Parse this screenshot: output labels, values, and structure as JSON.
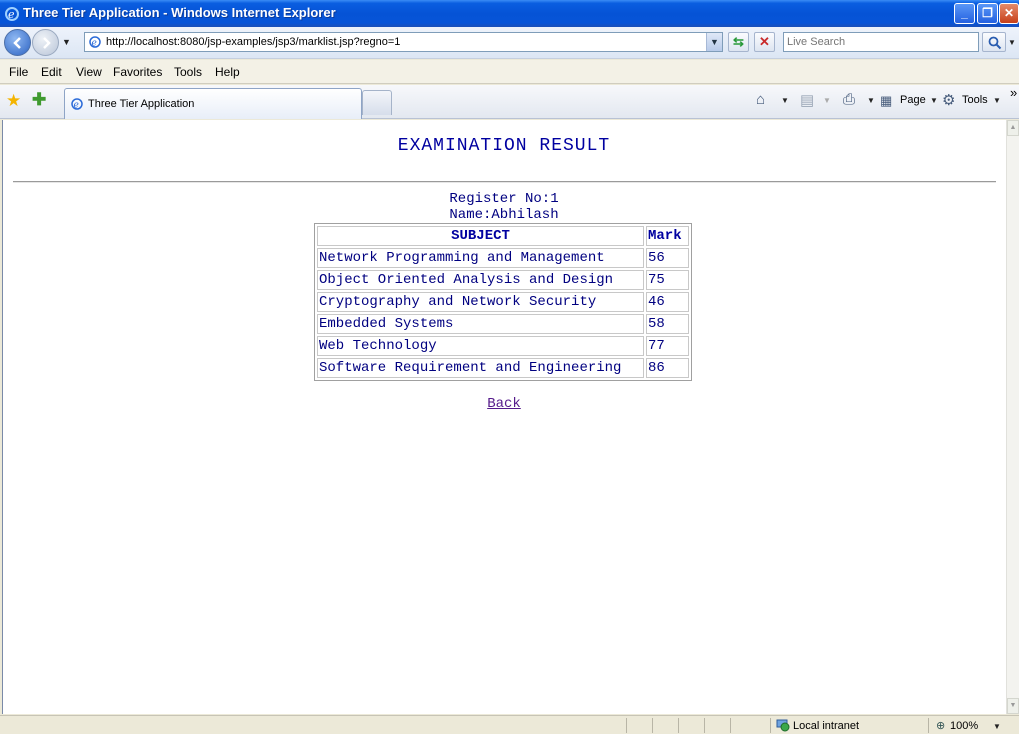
{
  "window": {
    "title": "Three Tier Application - Windows Internet Explorer"
  },
  "address_bar": {
    "url": "http://localhost:8080/jsp-examples/jsp3/marklist.jsp?regno=1"
  },
  "search": {
    "placeholder": "Live Search"
  },
  "menu": [
    "File",
    "Edit",
    "View",
    "Favorites",
    "Tools",
    "Help"
  ],
  "tab": {
    "label": "Three Tier Application"
  },
  "commands": {
    "page": "Page",
    "tools": "Tools",
    "more": "»"
  },
  "page": {
    "heading": "EXAMINATION RESULT",
    "register_no": "Register No:1",
    "name": "Name:Abhilash",
    "table": {
      "headers": [
        "SUBJECT",
        "Mark"
      ],
      "rows": [
        [
          "Network Programming and Management",
          "56"
        ],
        [
          "Object Oriented Analysis and Design",
          "75"
        ],
        [
          "Cryptography and Network Security",
          "46"
        ],
        [
          "Embedded Systems",
          "58"
        ],
        [
          "Web Technology",
          "77"
        ],
        [
          "Software Requirement and Engineering",
          "86"
        ]
      ]
    },
    "back_label": "Back"
  },
  "status": {
    "zone": "Local intranet",
    "zoom": "100%"
  },
  "colors": {
    "heading_text": "#0000a0",
    "body_text": "#000080",
    "visited_link": "#551a8b",
    "titlebar": "#0553d6"
  }
}
